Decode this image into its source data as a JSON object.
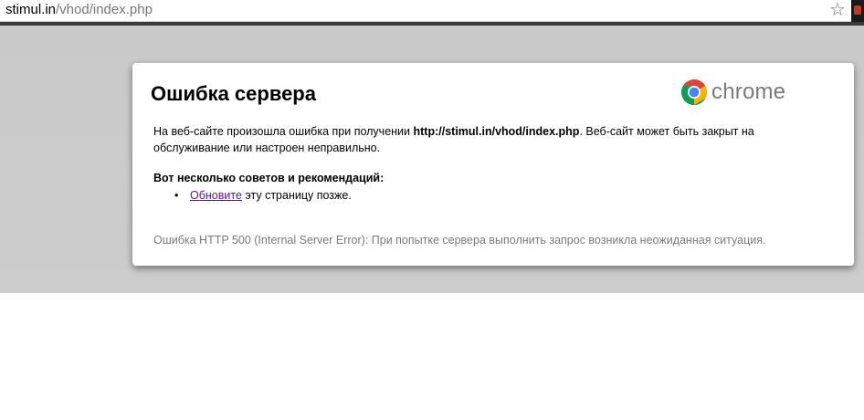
{
  "browser": {
    "url_host": "stimul.in",
    "url_path": "/vhod/index.php",
    "star_icon": "star-icon"
  },
  "error": {
    "title": "Ошибка сервера",
    "brand": "chrome",
    "message_before": "На веб-сайте произошла ошибка при получении ",
    "message_url": "http://stimul.in/vhod/index.php",
    "message_after": ". Веб-сайт может быть закрыт на обслуживание или настроен неправильно.",
    "tips_heading": "Вот несколько советов и рекомендаций:",
    "tip_link": "Обновите",
    "tip_rest": " эту страницу позже.",
    "code_text": "Ошибка HTTP 500 (Internal Server Error): При попытке сервера выполнить запрос возникла неожиданная ситуация."
  },
  "colors": {
    "background_grey": "#cbcbcb",
    "link_visited": "#551a8b",
    "muted_text": "#7a7a7a"
  }
}
